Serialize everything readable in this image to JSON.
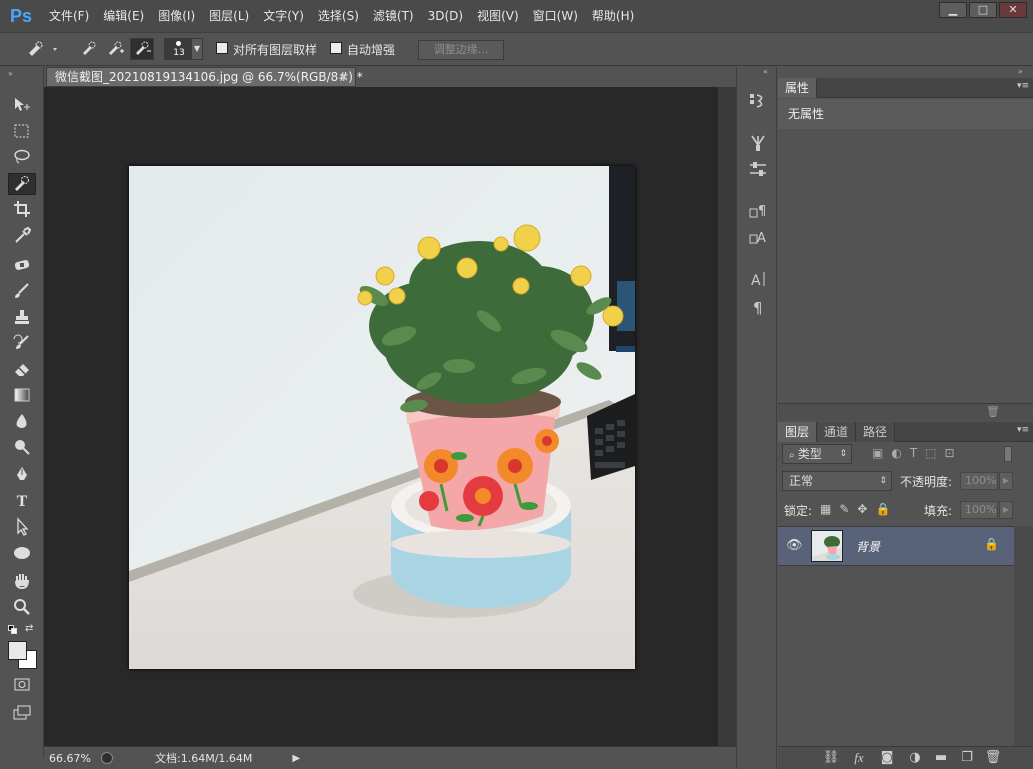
{
  "app": {
    "logo": "Ps"
  },
  "menu": [
    "文件(F)",
    "编辑(E)",
    "图像(I)",
    "图层(L)",
    "文字(Y)",
    "选择(S)",
    "滤镜(T)",
    "3D(D)",
    "视图(V)",
    "窗口(W)",
    "帮助(H)"
  ],
  "window_controls": {
    "minimize": "▁",
    "maximize": "□",
    "close": "✕"
  },
  "options": {
    "brush_size": "13",
    "sample_all_layers": "对所有图层取样",
    "auto_enhance": "自动增强",
    "refine_edge": "调整边缘..."
  },
  "document": {
    "tab_title": "微信截图_20210819134106.jpg @ 66.7%(RGB/8#) *",
    "tab_close": "×",
    "zoom": "66.67%",
    "doc_info": "文档:1.64M/1.64M"
  },
  "properties": {
    "tab": "属性",
    "body": "无属性"
  },
  "layers": {
    "tabs": [
      "图层",
      "通道",
      "路径"
    ],
    "filter_kind": "类型",
    "blend_mode": "正常",
    "opacity_label": "不透明度:",
    "opacity_value": "100%",
    "lock_label": "锁定:",
    "fill_label": "填充:",
    "fill_value": "100%",
    "layer_name": "背景"
  },
  "colors": {
    "accent": "#46a7ff",
    "canvas_bg": "#282828",
    "panel_bg": "#535353",
    "selected_layer": "#58637a"
  }
}
